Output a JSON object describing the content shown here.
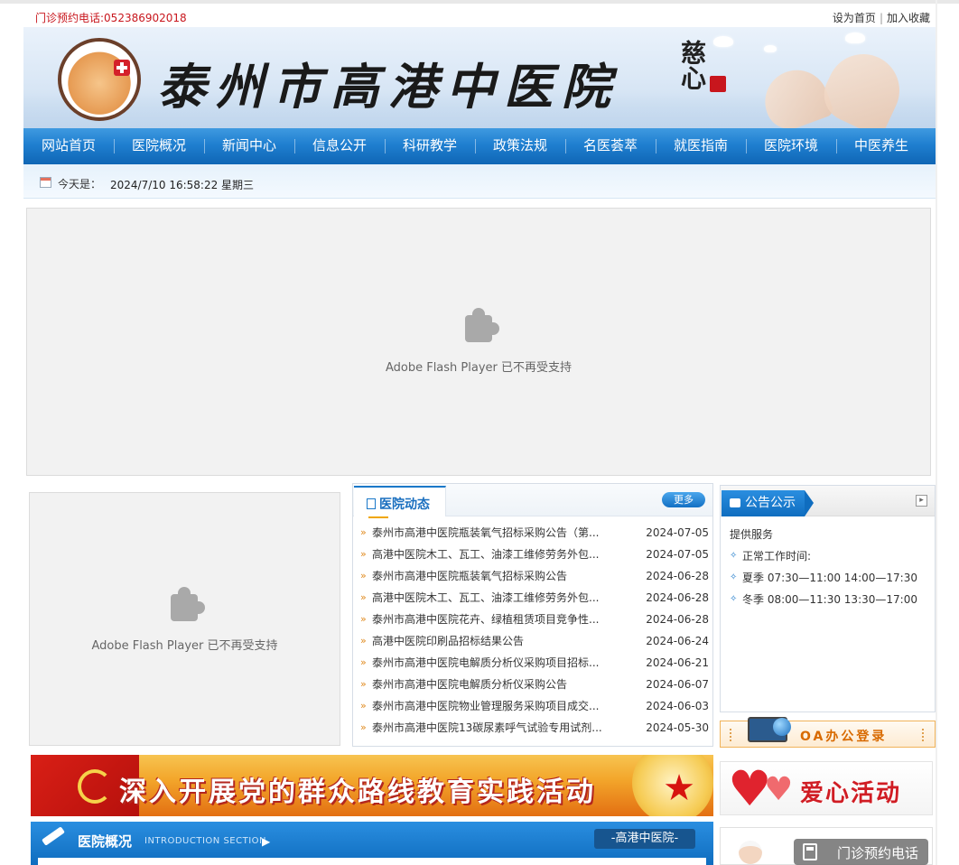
{
  "topbar": {
    "phone": "门诊预约电话:052386902018",
    "set_home": "设为首页",
    "add_favorite": "加入收藏"
  },
  "banner": {
    "title": "泰州市高港中医院",
    "motto": "慈心"
  },
  "nav": [
    "网站首页",
    "医院概况",
    "新闻中心",
    "信息公开",
    "科研教学",
    "政策法规",
    "名医荟萃",
    "就医指南",
    "医院环境",
    "中医养生"
  ],
  "datebar": {
    "label": "今天是：",
    "value": "2024/7/10 16:58:22 星期三"
  },
  "flash": {
    "message": "Adobe Flash Player 已不再受支持"
  },
  "news": {
    "tab": "医院动态",
    "more": "更多",
    "items": [
      {
        "title": "泰州市高港中医院瓶装氧气招标采购公告（第...",
        "date": "2024-07-05"
      },
      {
        "title": "高港中医院木工、瓦工、油漆工维修劳务外包...",
        "date": "2024-07-05"
      },
      {
        "title": "泰州市高港中医院瓶装氧气招标采购公告",
        "date": "2024-06-28"
      },
      {
        "title": "高港中医院木工、瓦工、油漆工维修劳务外包...",
        "date": "2024-06-28"
      },
      {
        "title": "泰州市高港中医院花卉、绿植租赁项目竞争性...",
        "date": "2024-06-28"
      },
      {
        "title": "高港中医院印刷品招标结果公告",
        "date": "2024-06-24"
      },
      {
        "title": "泰州市高港中医院电解质分析仪采购项目招标...",
        "date": "2024-06-21"
      },
      {
        "title": "泰州市高港中医院电解质分析仪采购公告",
        "date": "2024-06-07"
      },
      {
        "title": "泰州市高港中医院物业管理服务采购项目成交...",
        "date": "2024-06-03"
      },
      {
        "title": "泰州市高港中医院13碳尿素呼气试验专用试剂...",
        "date": "2024-05-30"
      }
    ]
  },
  "notice": {
    "tab": "公告公示",
    "line1": "提供服务",
    "line2": "正常工作时间:",
    "line3": "夏季 07:30—11:00 14:00—17:30",
    "line4": "冬季 08:00—11:30 13:30—17:00"
  },
  "oa": {
    "label": "OA办公登录"
  },
  "party_banner": {
    "text": "深入开展党的群众路线教育实践活动"
  },
  "love_banner": {
    "text": "爱心活动"
  },
  "intro": {
    "title": "医院概况",
    "subtitle": "INTRODUCTION SECTION",
    "badge": "-高港中医院-"
  },
  "float_phone": {
    "label": "门诊预约电话"
  },
  "colors": {
    "nav_blue": "#1f7fd0",
    "accent_red": "#c8161d",
    "orange": "#e08a1e"
  }
}
